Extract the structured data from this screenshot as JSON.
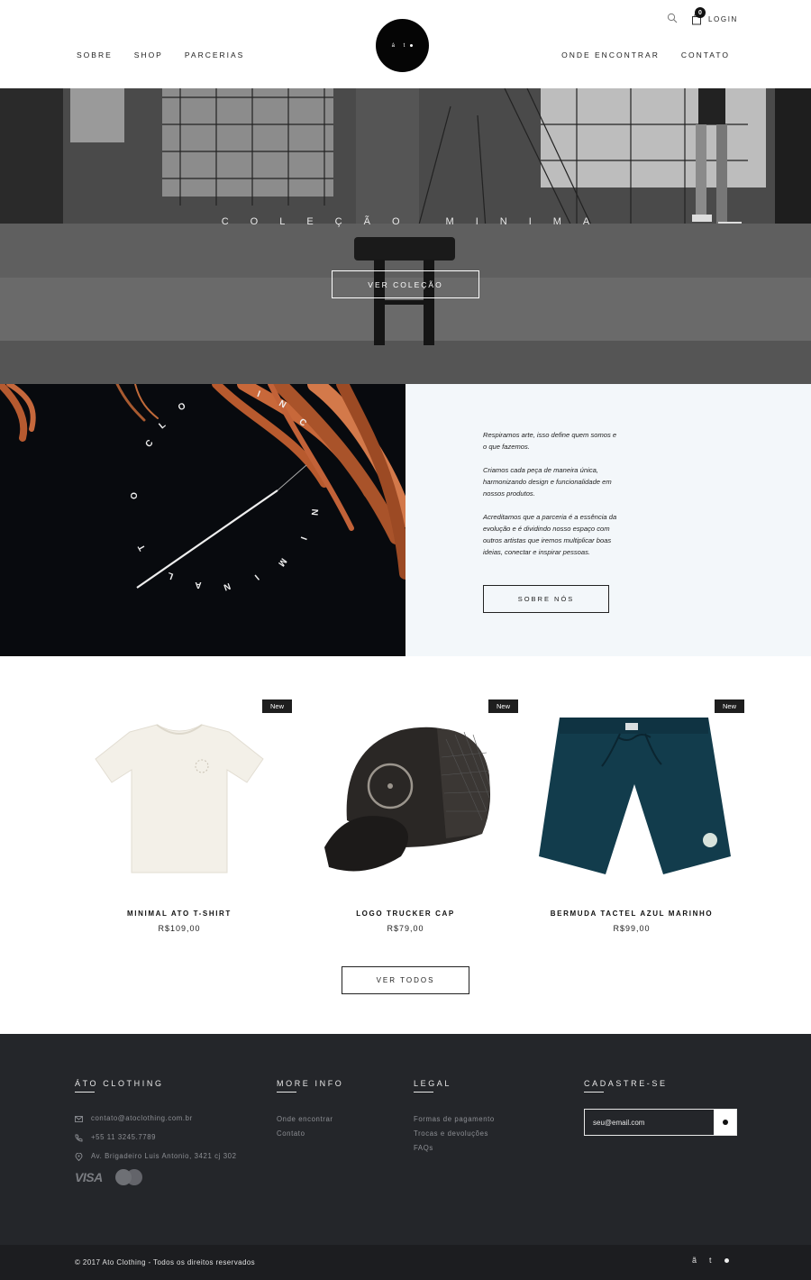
{
  "header": {
    "nav_left": [
      "SOBRE",
      "SHOP",
      "PARCERIAS"
    ],
    "nav_right": [
      "ONDE ENCONTRAR",
      "CONTATO"
    ],
    "logo_text": "á t",
    "cart_count": "0",
    "login": "LOGIN",
    "icons": [
      "search-icon",
      "cart-icon"
    ]
  },
  "hero": {
    "title": "COLEÇÃO MINIMA",
    "button": "VER COLEÇÃO"
  },
  "about": {
    "paragraphs": [
      "Respiramos arte, isso define quem somos e o que fazemos.",
      "Criamos cada peça de maneira única, harmonizando design e funcionalidade em nossos produtos.",
      "Acreditamos que a parceria é a essência da evolução e é dividindo nosso espaço com outros artistas que iremos multiplicar boas ideias, conectar e inspirar pessoas."
    ],
    "button": "SOBRE NÓS",
    "image_letters": [
      "C",
      "O",
      "L",
      "E",
      "Ç",
      "Ã",
      "O",
      "M",
      "I",
      "N",
      "I",
      "M",
      "A",
      "A",
      "T",
      "O"
    ]
  },
  "products": [
    {
      "badge": "New",
      "name": "MINIMAL ATO T-SHIRT",
      "price": "R$109,00"
    },
    {
      "badge": "New",
      "name": "LOGO TRUCKER CAP",
      "price": "R$79,00"
    },
    {
      "badge": "New",
      "name": "BERMUDA TACTEL AZUL MARINHO",
      "price": "R$99,00"
    }
  ],
  "view_all": "VER TODOS",
  "footer": {
    "brand": {
      "heading": "ÁTO CLOTHING",
      "email": "contato@atoclothing.com.br",
      "phone": "+55 11 3245.7789",
      "address": "Av. Brigadeiro Luis Antonio, 3421 cj 302",
      "payment_visa": "VISA",
      "icons": [
        "mail-icon",
        "phone-icon",
        "location-icon",
        "mastercard-icon"
      ]
    },
    "more_info": {
      "heading": "MORE INFO",
      "links": [
        "Onde encontrar",
        "Contato"
      ]
    },
    "legal": {
      "heading": "LEGAL",
      "links": [
        "Formas de pagamento",
        "Trocas e devoluções",
        "FAQs"
      ]
    },
    "signup": {
      "heading": "CADASTRE-SE",
      "placeholder": "seu@email.com"
    }
  },
  "bottom": {
    "copyright": "© 2017 Ato Clothing - Todos os direitos reservados",
    "logo_a": "ã",
    "logo_t": "t"
  },
  "colors": {
    "footer_bg": "#24262a",
    "bottom_bg": "#1c1d20",
    "about_panel_bg": "#f3f7fa",
    "badge_bg": "#1e1e1e",
    "shorts_navy": "#123c4c"
  }
}
